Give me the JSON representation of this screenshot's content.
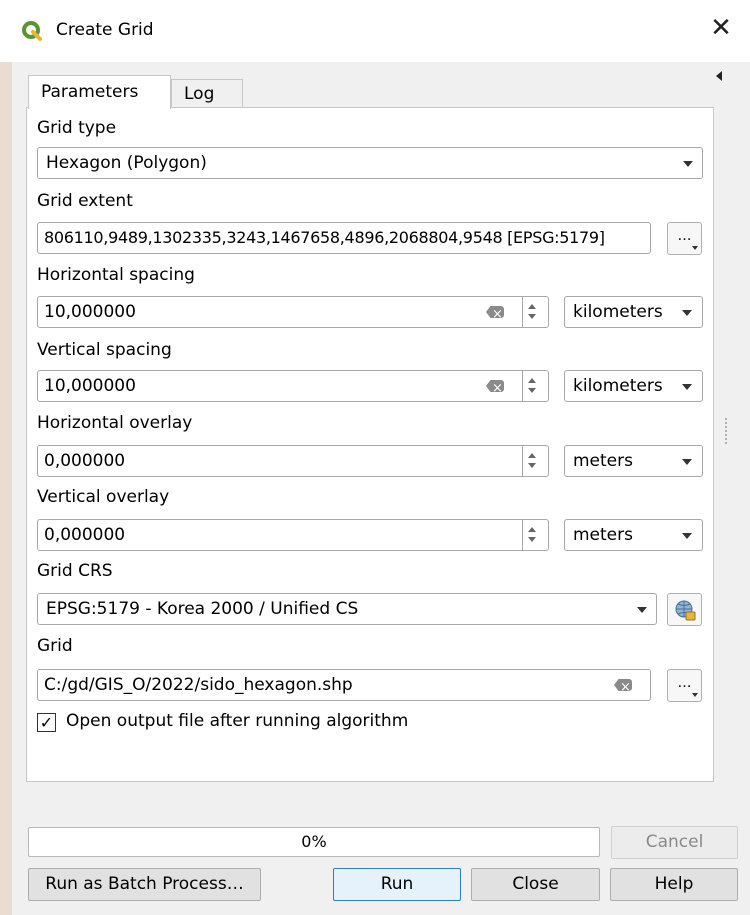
{
  "window": {
    "title": "Create Grid",
    "close_glyph": "✕"
  },
  "tabs": [
    {
      "label": "Parameters"
    },
    {
      "label": "Log"
    }
  ],
  "params": {
    "grid_type": {
      "label": "Grid type",
      "value": "Hexagon (Polygon)"
    },
    "grid_extent": {
      "label": "Grid extent",
      "value": "806110,9489,1302335,3243,1467658,4896,2068804,9548 [EPSG:5179]",
      "button": "…"
    },
    "h_spacing": {
      "label": "Horizontal spacing",
      "value": "10,000000",
      "unit": "kilometers"
    },
    "v_spacing": {
      "label": "Vertical spacing",
      "value": "10,000000",
      "unit": "kilometers"
    },
    "h_overlay": {
      "label": "Horizontal overlay",
      "value": "0,000000",
      "unit": "meters"
    },
    "v_overlay": {
      "label": "Vertical overlay",
      "value": "0,000000",
      "unit": "meters"
    },
    "grid_crs": {
      "label": "Grid CRS",
      "value": "EPSG:5179 - Korea 2000 / Unified CS"
    },
    "grid_output": {
      "label": "Grid",
      "value": "C:/gd/GIS_O/2022/sido_hexagon.shp",
      "button": "…"
    },
    "open_output": {
      "label": "Open output file after running algorithm",
      "checked": true,
      "mark": "✓"
    }
  },
  "footer": {
    "progress": "0%",
    "progress_value": 0,
    "cancel": "Cancel",
    "batch": "Run as Batch Process…",
    "run": "Run",
    "close": "Close",
    "help": "Help"
  },
  "colors": {
    "qgis_green": "#589632",
    "default_button_border": "#2a7fd4"
  },
  "icons": [
    "qgis-logo-icon",
    "close-icon",
    "clear-icon",
    "spin-icon",
    "dropdown-arrow-icon",
    "globe-crs-icon",
    "collapse-arrow-icon"
  ]
}
